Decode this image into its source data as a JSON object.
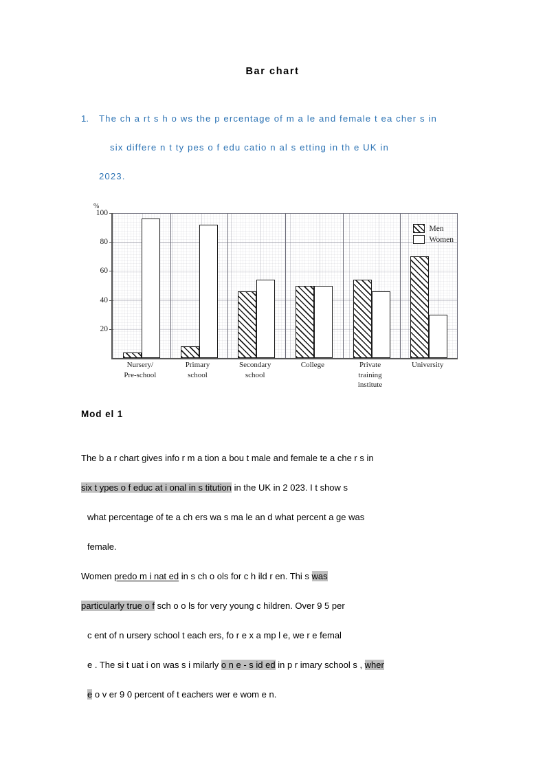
{
  "document": {
    "title": "Bar chart",
    "prompt": {
      "number": "1.",
      "lines": [
        "The ch a rt  s h o ws the    p ercentage  of m a le  and  female  t ea cher s  in",
        "six   differe n t ty pes   o f  edu catio n al s etting   in th e UK  in",
        "2023."
      ]
    },
    "model_heading": "Mod el 1",
    "paragraphs": [
      {
        "id": "para-1",
        "lines": [
          [
            {
              "t": "The    b a r    chart gives info r m a tion a bou t    male and female   te a che r s in",
              "style": "plain"
            }
          ],
          [
            {
              "t": "six  t ypes o f educ at i onal   in s titution",
              "style": "highlight"
            },
            {
              "t": " in the UK  in  2 023. I t show s",
              "style": "plain"
            }
          ],
          [
            {
              "t": "what    percentage of te a ch ers   wa s    ma le an d   what percent a ge was",
              "style": "plain"
            }
          ],
          [
            {
              "t": "female.",
              "style": "plain"
            }
          ]
        ]
      },
      {
        "id": "para-2",
        "lines": [
          [
            {
              "t": "Women ",
              "style": "plain"
            },
            {
              "t": "predo m i nat ed",
              "style": "underline"
            },
            {
              "t": "  in   s ch o ols for   c h ild r en.   Thi s ",
              "style": "plain"
            },
            {
              "t": "was ",
              "style": "highlight"
            }
          ],
          [
            {
              "t": "particularly true o f",
              "style": "highlight"
            },
            {
              "t": " sch o o ls for very  young   c hildren.   Over   9 5 per",
              "style": "plain"
            }
          ],
          [
            {
              "t": "c ent of n ursery school   t each ers,  fo r e x a mp l e,   we r e  femal",
              "style": "plain"
            }
          ],
          [
            {
              "t": "e .  The si t uat i on   was s i milarly  ",
              "style": "plain"
            },
            {
              "t": "o n e - s id ed",
              "style": "highlight"
            },
            {
              "t": " in p r imary school s , ",
              "style": "plain"
            },
            {
              "t": "wher",
              "style": "highlight"
            }
          ],
          [
            {
              "t": "e",
              "style": "highlight"
            },
            {
              "t": "  o v er 9 0 percent of    t eachers wer e wom e n.",
              "style": "plain"
            }
          ]
        ]
      }
    ]
  },
  "chart_data": {
    "type": "bar",
    "title": "",
    "xlabel": "",
    "ylabel": "%",
    "ylim": [
      0,
      100
    ],
    "yticks": [
      20,
      40,
      60,
      80,
      100
    ],
    "ytick_labels": [
      "20",
      "40",
      "60",
      "80",
      "100"
    ],
    "grid": true,
    "legend_position": "top-right",
    "categories": [
      "Nursery/ Pre-school",
      "Primary school",
      "Secondary school",
      "College",
      "Private training institute",
      "University"
    ],
    "category_lines": [
      [
        "Nursery/",
        "Pre-school"
      ],
      [
        "Primary",
        "school"
      ],
      [
        "Secondary",
        "school"
      ],
      [
        "College"
      ],
      [
        "Private",
        "training",
        "institute"
      ],
      [
        "University"
      ]
    ],
    "series": [
      {
        "name": "Men",
        "fill": "hatched",
        "values": [
          4,
          8,
          46,
          50,
          54,
          70
        ]
      },
      {
        "name": "Women",
        "fill": "white",
        "values": [
          96,
          92,
          54,
          50,
          46,
          30
        ]
      }
    ]
  },
  "colors": {
    "prompt_text": "#2E74B5",
    "highlight": "#BFBFBF",
    "ink": "#1a1a1a",
    "grid": "#6b6b78"
  }
}
